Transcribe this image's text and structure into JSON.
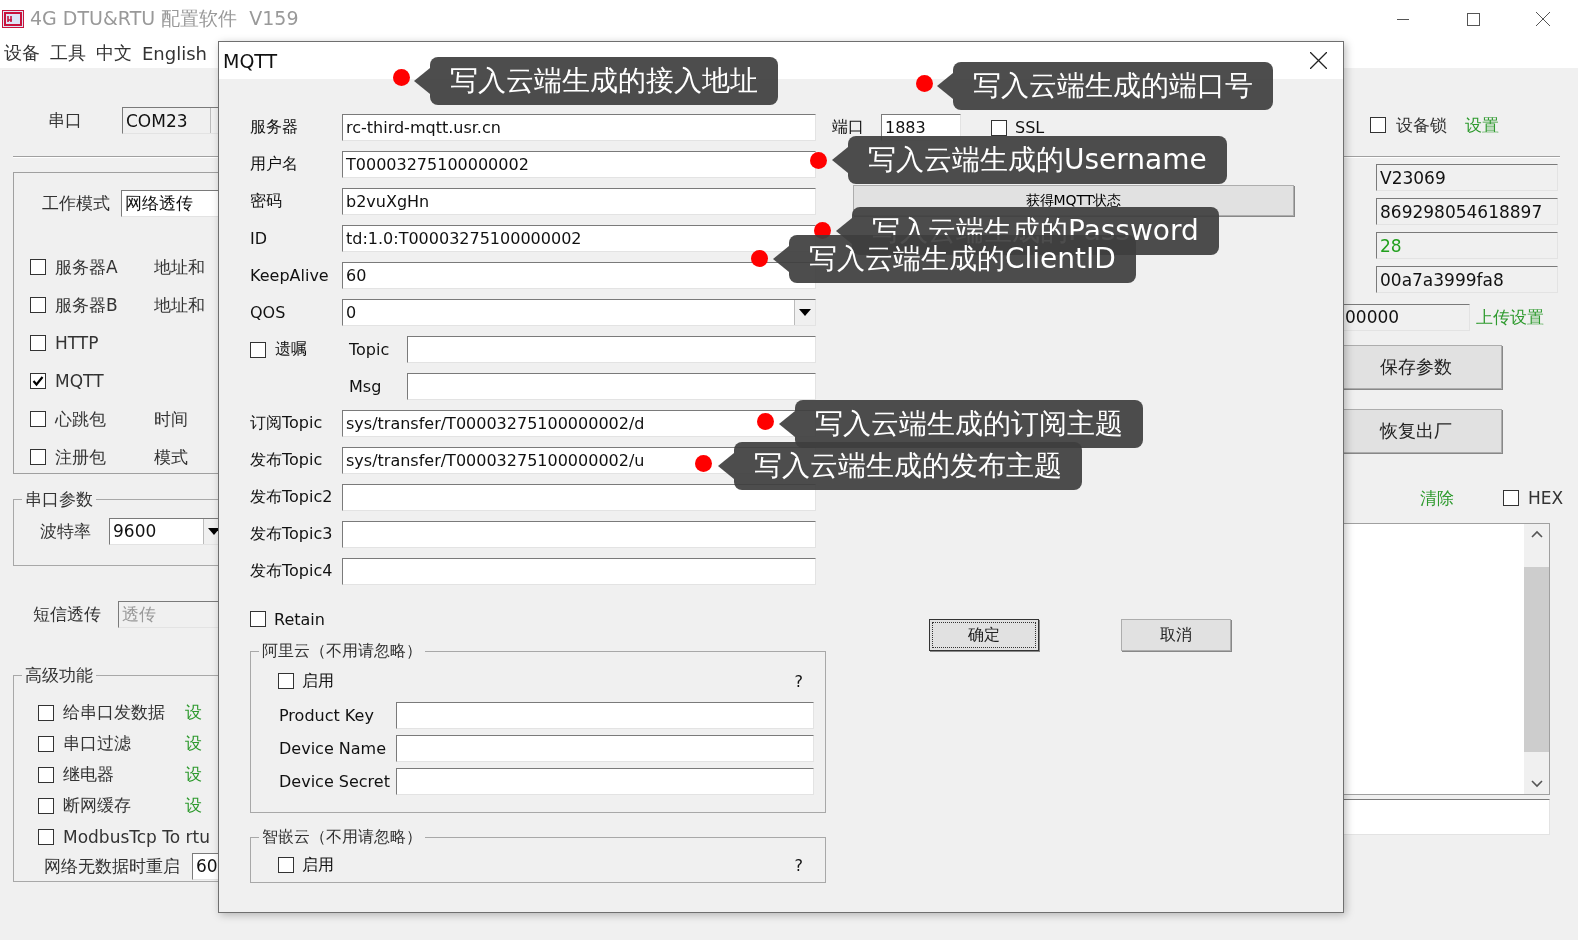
{
  "window": {
    "title": "4G DTU&RTU 配置软件  V159"
  },
  "menu": [
    "设备",
    "工具",
    "中文",
    "English"
  ],
  "main": {
    "port": {
      "label": "串口",
      "value": "COM23"
    },
    "work_mode": {
      "label": "工作模式",
      "value": "网络透传"
    },
    "channels": [
      {
        "label": "服务器A",
        "checked": false,
        "note": "地址和"
      },
      {
        "label": "服务器B",
        "checked": false,
        "note": "地址和"
      },
      {
        "label": "HTTP",
        "checked": false
      },
      {
        "label": "MQTT",
        "checked": true
      },
      {
        "label": "心跳包",
        "checked": false,
        "note": "时间"
      },
      {
        "label": "注册包",
        "checked": false,
        "note": "模式"
      }
    ],
    "serial": {
      "title": "串口参数",
      "baud_label": "波特率",
      "baud": "9600"
    },
    "sms": {
      "label": "短信透传",
      "value": "透传",
      "disabled": true
    },
    "advanced": {
      "title": "高级功能",
      "items": [
        {
          "label": "给串口发数据",
          "checked": false,
          "link": "设"
        },
        {
          "label": "串口过滤",
          "checked": false,
          "link": "设"
        },
        {
          "label": "继电器",
          "checked": false,
          "link": "设"
        },
        {
          "label": "断网缓存",
          "checked": false,
          "link": "设"
        },
        {
          "label": "ModbusTcp To rtu",
          "checked": false
        }
      ],
      "restart_label": "网络无数据时重启",
      "restart_value": "60"
    },
    "device_lock": {
      "label": "设备锁",
      "checked": false,
      "link": "设置"
    },
    "info": [
      {
        "value": "V23069"
      },
      {
        "value": "869298054618897"
      },
      {
        "value": "28",
        "color": "#22a01e"
      },
      {
        "value": "00a7a3999fa8"
      }
    ],
    "upload": {
      "value": "00000",
      "link": "上传设置"
    },
    "buttons": [
      "保存参数",
      "恢复出厂"
    ],
    "log": {
      "clear": "清除",
      "hex_label": "HEX",
      "hex_checked": false
    }
  },
  "dialog": {
    "title": "MQTT",
    "fields": [
      {
        "kind": "text",
        "label": "服务器",
        "value": "rc-third-mqtt.usr.cn"
      },
      {
        "kind": "text",
        "label": "用户名",
        "value": "T00003275100000002"
      },
      {
        "kind": "text",
        "label": "密码",
        "value": "b2vuXgHn"
      },
      {
        "kind": "text",
        "label": "ID",
        "value": "td:1.0:T00003275100000002"
      },
      {
        "kind": "text",
        "label": "KeepAlive",
        "value": "60"
      },
      {
        "kind": "select",
        "label": "QOS",
        "value": "0"
      }
    ],
    "will": {
      "label": "遗嘱",
      "checked": false,
      "topic_label": "Topic",
      "msg_label": "Msg"
    },
    "topics": [
      {
        "label": "订阅Topic",
        "value": "sys/transfer/T00003275100000002/d"
      },
      {
        "label": "发布Topic",
        "value": "sys/transfer/T00003275100000002/u"
      },
      {
        "label": "发布Topic2"
      },
      {
        "label": "发布Topic3"
      },
      {
        "label": "发布Topic4"
      }
    ],
    "port": {
      "label": "端口",
      "value": "1883"
    },
    "ssl": {
      "label": "SSL",
      "checked": false
    },
    "status_button": "获得MQTT状态",
    "retain": {
      "label": "Retain",
      "checked": false
    },
    "aliyun": {
      "title": "阿里云（不用请忽略）",
      "enable": {
        "label": "启用",
        "checked": false
      },
      "help": "?",
      "fields": [
        {
          "label": "Product Key"
        },
        {
          "label": "Device Name"
        },
        {
          "label": "Device Secret"
        }
      ]
    },
    "zhiqian": {
      "title": "智嵌云（不用请忽略）",
      "enable": {
        "label": "启用",
        "checked": false
      },
      "help": "?"
    },
    "buttons": [
      {
        "label": "确定",
        "focused": true
      },
      {
        "label": "取消",
        "focused": false
      }
    ]
  },
  "annotations": [
    {
      "text": "写入云端生成的接入地址"
    },
    {
      "text": "写入云端生成的端口号"
    },
    {
      "text": "写入云端生成的Username"
    },
    {
      "text": "写入云端生成的Password"
    },
    {
      "text": "写入云端生成的ClientID"
    },
    {
      "text": "写入云端生成的订阅主题"
    },
    {
      "text": "写入云端生成的发布主题"
    }
  ]
}
